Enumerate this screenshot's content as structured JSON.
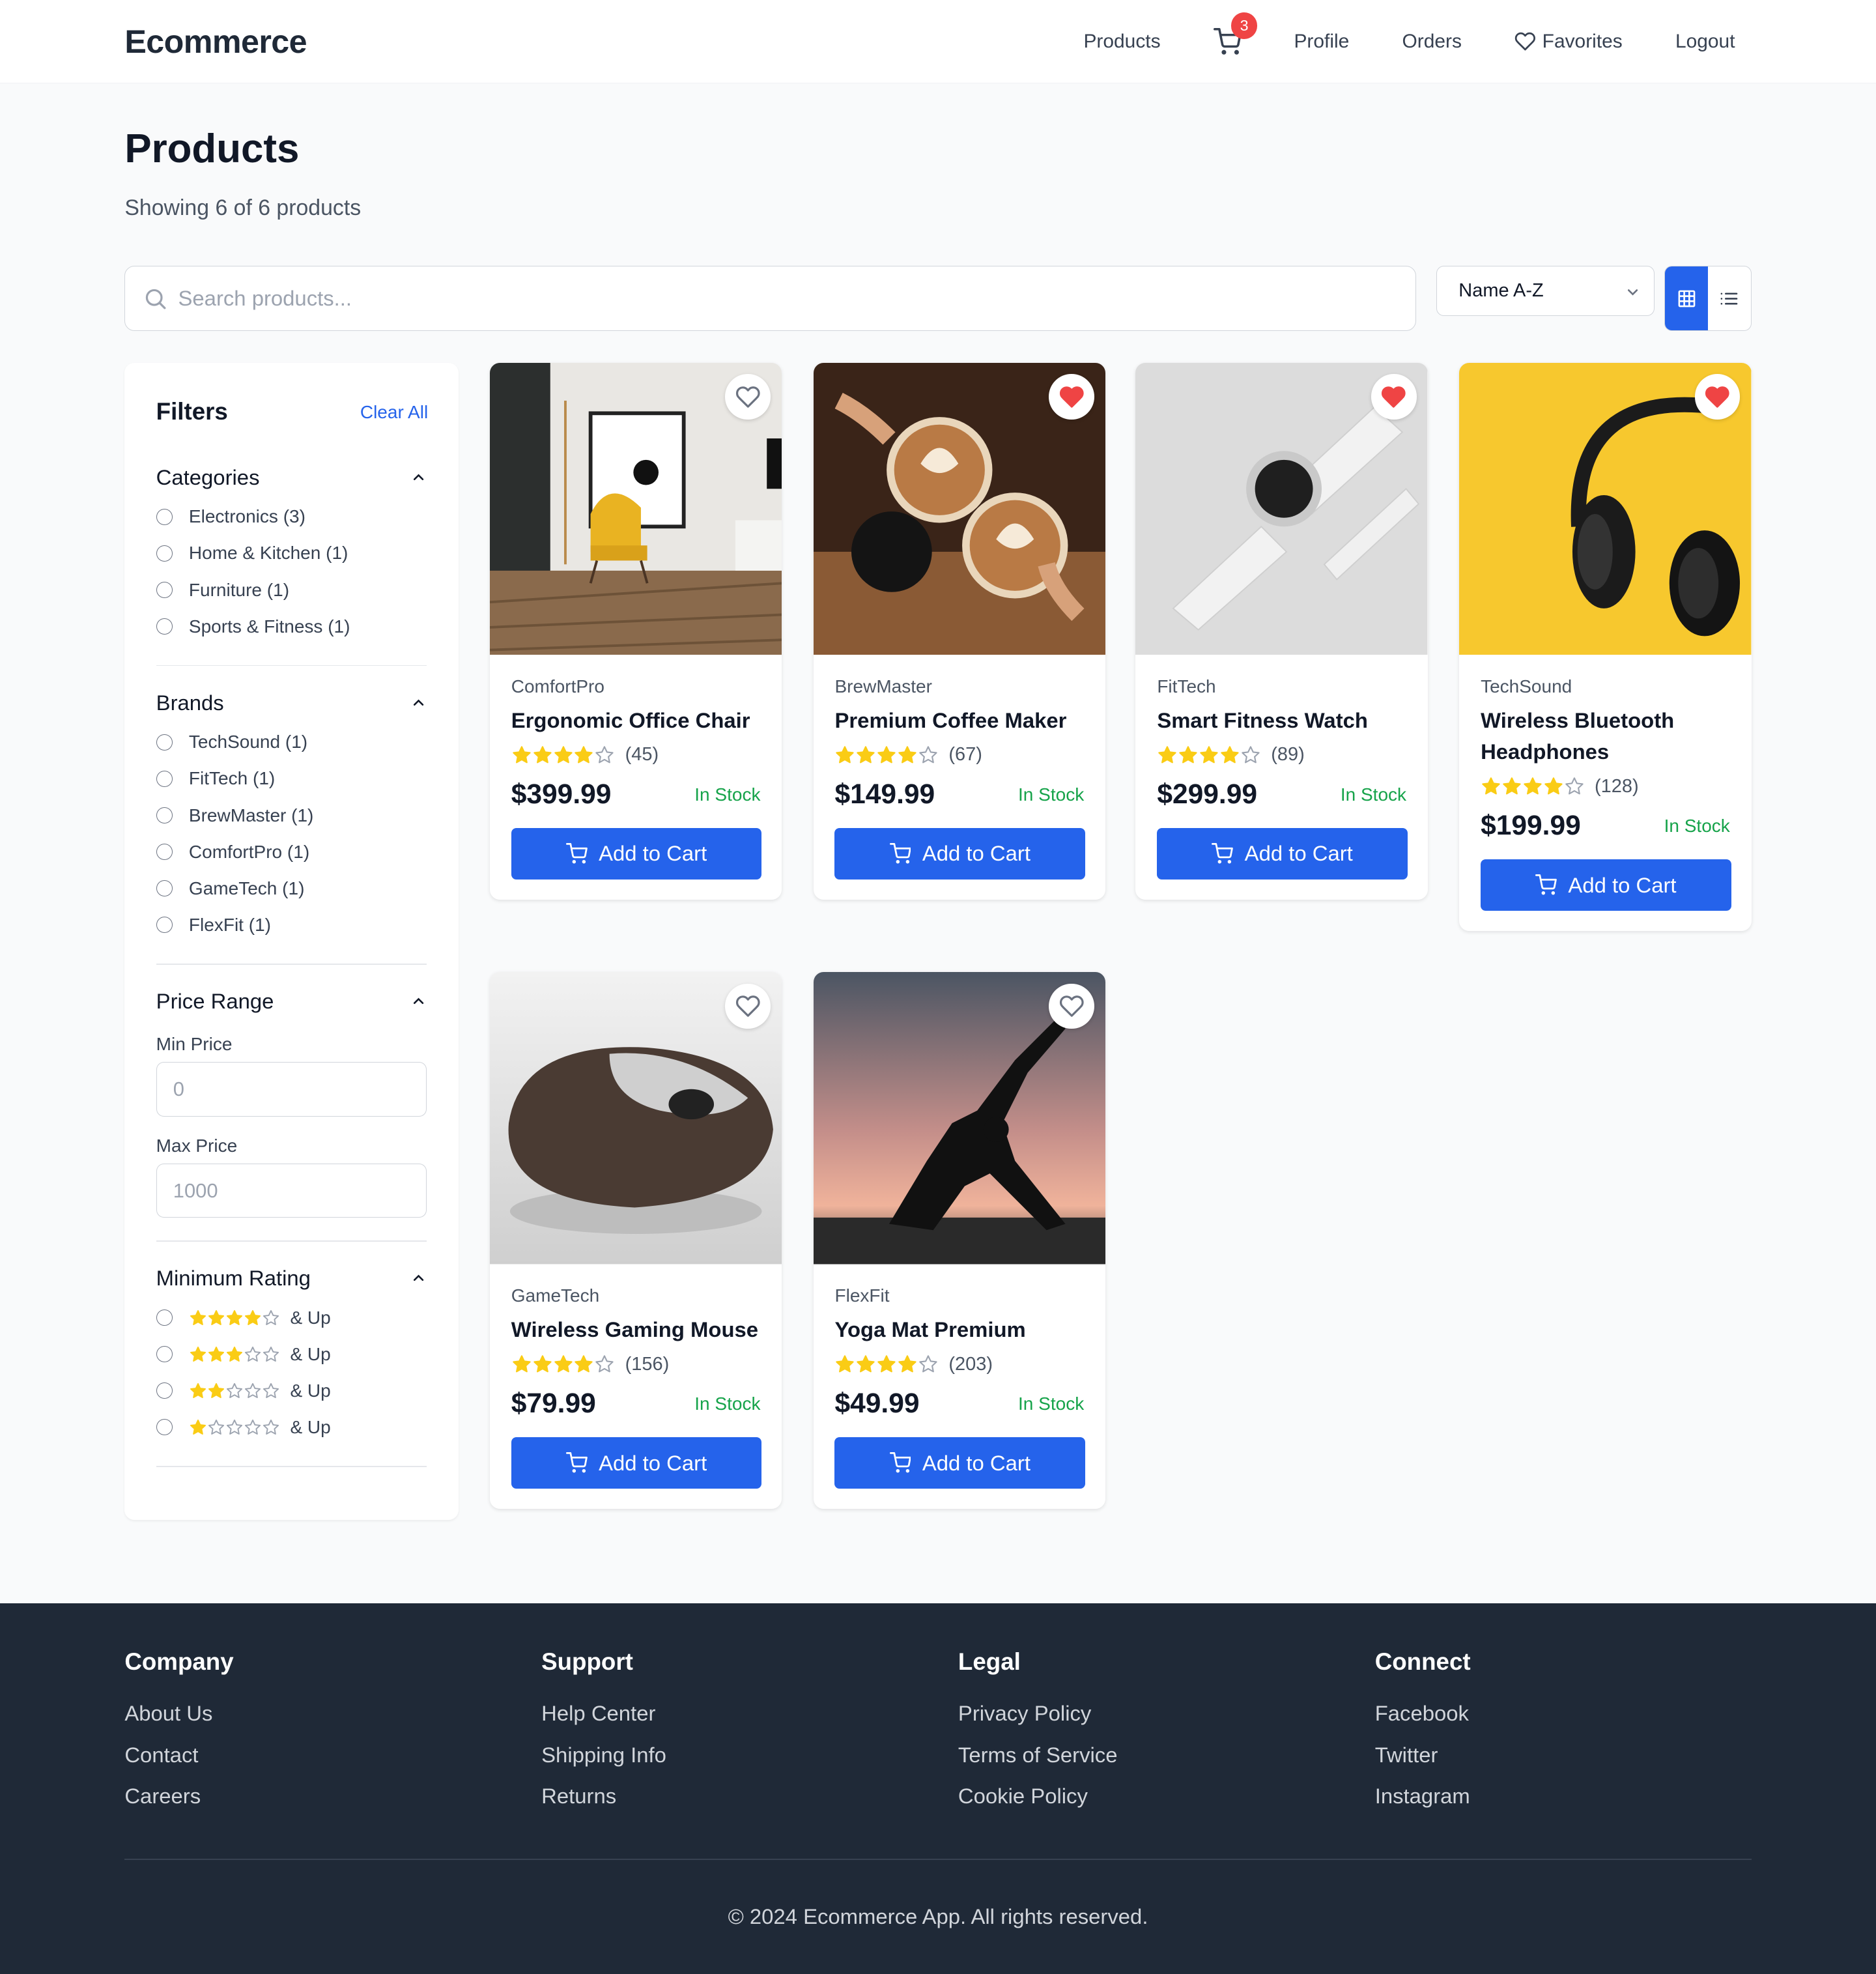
{
  "header": {
    "logo": "Ecommerce",
    "nav": {
      "products": "Products",
      "cart_count": "3",
      "profile": "Profile",
      "orders": "Orders",
      "favorites": "Favorites",
      "logout": "Logout"
    }
  },
  "main": {
    "title": "Products",
    "subtitle": "Showing 6 of 6 products",
    "search": {
      "placeholder": "Search products...",
      "value": ""
    },
    "sort": {
      "selected": "Name A-Z"
    },
    "view_mode": "grid"
  },
  "filters": {
    "title": "Filters",
    "clear_label": "Clear All",
    "categories": {
      "title": "Categories",
      "options": [
        "Electronics (3)",
        "Home & Kitchen (1)",
        "Furniture (1)",
        "Sports & Fitness (1)"
      ]
    },
    "brands": {
      "title": "Brands",
      "options": [
        "TechSound (1)",
        "FitTech (1)",
        "BrewMaster (1)",
        "ComfortPro (1)",
        "GameTech (1)",
        "FlexFit (1)"
      ]
    },
    "price": {
      "title": "Price Range",
      "min_label": "Min Price",
      "min_placeholder": "0",
      "max_label": "Max Price",
      "max_placeholder": "1000"
    },
    "rating": {
      "title": "Minimum Rating",
      "options": [
        {
          "stars": 4,
          "label": "& Up"
        },
        {
          "stars": 3,
          "label": "& Up"
        },
        {
          "stars": 2,
          "label": "& Up"
        },
        {
          "stars": 1,
          "label": "& Up"
        }
      ]
    }
  },
  "products": [
    {
      "brand": "ComfortPro",
      "name": "Ergonomic Office Chair",
      "rating": 4,
      "reviews": "(45)",
      "price": "$399.99",
      "stock": "In Stock",
      "favorite": false,
      "image": "office-chair-photo",
      "cta": "Add to Cart"
    },
    {
      "brand": "BrewMaster",
      "name": "Premium Coffee Maker",
      "rating": 4,
      "reviews": "(67)",
      "price": "$149.99",
      "stock": "In Stock",
      "favorite": true,
      "image": "coffee-cups-photo",
      "cta": "Add to Cart"
    },
    {
      "brand": "FitTech",
      "name": "Smart Fitness Watch",
      "rating": 4,
      "reviews": "(89)",
      "price": "$299.99",
      "stock": "In Stock",
      "favorite": true,
      "image": "smart-watch-photo",
      "cta": "Add to Cart"
    },
    {
      "brand": "TechSound",
      "name": "Wireless Bluetooth Headphones",
      "rating": 4,
      "reviews": "(128)",
      "price": "$199.99",
      "stock": "In Stock",
      "favorite": true,
      "image": "headphones-photo",
      "cta": "Add to Cart"
    },
    {
      "brand": "GameTech",
      "name": "Wireless Gaming Mouse",
      "rating": 4,
      "reviews": "(156)",
      "price": "$79.99",
      "stock": "In Stock",
      "favorite": false,
      "image": "mouse-photo",
      "cta": "Add to Cart"
    },
    {
      "brand": "FlexFit",
      "name": "Yoga Mat Premium",
      "rating": 4,
      "reviews": "(203)",
      "price": "$49.99",
      "stock": "In Stock",
      "favorite": false,
      "image": "yoga-photo",
      "cta": "Add to Cart"
    }
  ],
  "footer": {
    "columns": [
      {
        "title": "Company",
        "links": [
          "About Us",
          "Contact",
          "Careers"
        ]
      },
      {
        "title": "Support",
        "links": [
          "Help Center",
          "Shipping Info",
          "Returns"
        ]
      },
      {
        "title": "Legal",
        "links": [
          "Privacy Policy",
          "Terms of Service",
          "Cookie Policy"
        ]
      },
      {
        "title": "Connect",
        "links": [
          "Facebook",
          "Twitter",
          "Instagram"
        ]
      }
    ],
    "copyright": "© 2024 Ecommerce App. All rights reserved."
  },
  "colors": {
    "accent": "#2563eb",
    "star": "#facc15",
    "in_stock": "#16a34a",
    "favorite": "#ef4444",
    "footer_bg": "#1f2937"
  }
}
